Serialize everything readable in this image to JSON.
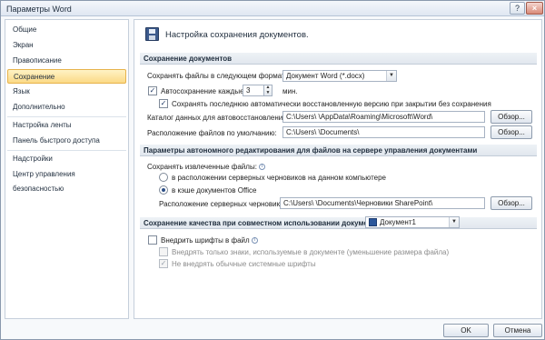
{
  "window": {
    "title": "Параметры Word",
    "help_label": "?",
    "close_label": "×"
  },
  "sidebar": {
    "items": [
      {
        "label": "Общие"
      },
      {
        "label": "Экран"
      },
      {
        "label": "Правописание"
      },
      {
        "label": "Сохранение",
        "selected": true
      },
      {
        "label": "Язык"
      },
      {
        "label": "Дополнительно"
      },
      {
        "label": "Настройка ленты"
      },
      {
        "label": "Панель быстрого доступа"
      },
      {
        "label": "Надстройки"
      },
      {
        "label": "Центр управления безопасностью"
      }
    ]
  },
  "main": {
    "heading": "Настройка сохранения документов.",
    "save_section": {
      "title": "Сохранение документов",
      "format_label": "Сохранять файлы в следующем формате:",
      "format_value": "Документ Word (*.docx)",
      "autosave_label": "Автосохранение каждые",
      "autosave_value": "3",
      "autosave_unit": "мин.",
      "keep_last_label": "Сохранять последнюю автоматически восстановленную версию при закрытии без сохранения",
      "autorecover_label": "Каталог данных для автовосстановления:",
      "autorecover_path": "C:\\Users\\                   \\AppData\\Roaming\\Microsoft\\Word\\",
      "default_label": "Расположение файлов по умолчанию:",
      "default_path": "C:\\Users\\                   \\Documents\\",
      "browse_label": "Обзор..."
    },
    "offline_section": {
      "title": "Параметры автономного редактирования для файлов на сервере управления документами",
      "save_checked_label": "Сохранять извлеченные файлы:",
      "radio_server_label": "в расположении серверных черновиков на данном компьютере",
      "radio_cache_label": "в кэше документов Office",
      "drafts_label": "Расположение серверных черновиков:",
      "drafts_path": "C:\\Users\\              \\Documents\\Черновики SharePoint\\",
      "browse_label": "Обзор..."
    },
    "quality_section": {
      "title": "Сохранение качества при совместном использовании документа:",
      "document_value": "Документ1",
      "embed_fonts_label": "Внедрить шрифты в файл",
      "embed_used_label": "Внедрять только знаки, используемые в документе (уменьшение размера файла)",
      "no_system_label": "Не внедрять обычные системные шрифты"
    }
  },
  "footer": {
    "ok_label": "OK",
    "cancel_label": "Отмена"
  },
  "icons": {
    "save": "floppy-disk-icon",
    "info": "info-icon",
    "doc": "word-document-icon"
  }
}
